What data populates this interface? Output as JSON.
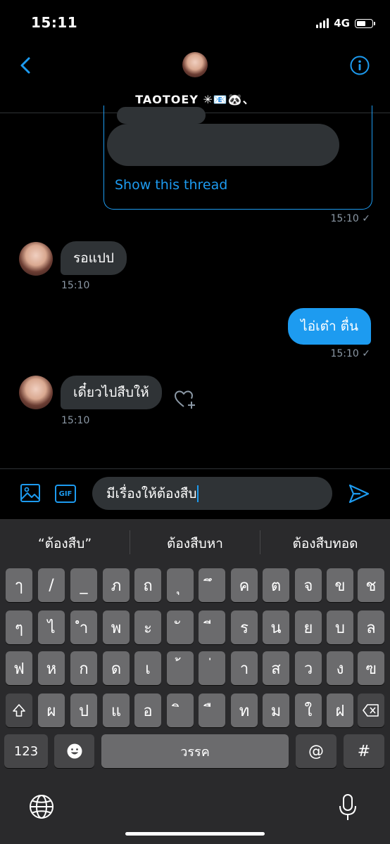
{
  "status_bar": {
    "time": "15:11",
    "network": "4G"
  },
  "chat": {
    "title": "TAOTOEY ✳︎📧🐼、"
  },
  "thread_card": {
    "link": "Show this thread",
    "time": "15:10 ✓"
  },
  "messages": [
    {
      "direction": "in",
      "text": "รอแปป",
      "time": "15:10"
    },
    {
      "direction": "out",
      "text": "ไอ่เต๋า ตื่น",
      "time": "15:10 ✓"
    },
    {
      "direction": "in",
      "text": "เดี๋ยวไปสืบให้",
      "time": "15:10"
    }
  ],
  "compose": {
    "gif_label": "GIF",
    "draft": "มีเรื่องให้ต้องสืบ"
  },
  "keyboard": {
    "suggestions": [
      "“ต้องสืบ”",
      "ต้องสืบหา",
      "ต้องสืบทอด"
    ],
    "rows": [
      [
        "ๅ",
        "/",
        "_",
        "ภ",
        "ถ",
        "ุ",
        "ึ",
        "ค",
        "ต",
        "จ",
        "ข",
        "ช"
      ],
      [
        "ๆ",
        "ไ",
        "ำ",
        "พ",
        "ะ",
        "ั",
        "ี",
        "ร",
        "น",
        "ย",
        "บ",
        "ล"
      ],
      [
        "ฟ",
        "ห",
        "ก",
        "ด",
        "เ",
        "้",
        "่",
        "า",
        "ส",
        "ว",
        "ง",
        "ฃ"
      ],
      [
        "ผ",
        "ป",
        "แ",
        "อ",
        "ิ",
        "ื",
        "ท",
        "ม",
        "ใ",
        "ฝ"
      ]
    ],
    "numbers_label": "123",
    "space_label": "วรรค",
    "at_label": "@",
    "hash_label": "#"
  },
  "colors": {
    "accent": "#1d9bf0",
    "incoming_bubble": "#2f3336",
    "key": "#6b6b6d",
    "key_fn": "#464648"
  }
}
